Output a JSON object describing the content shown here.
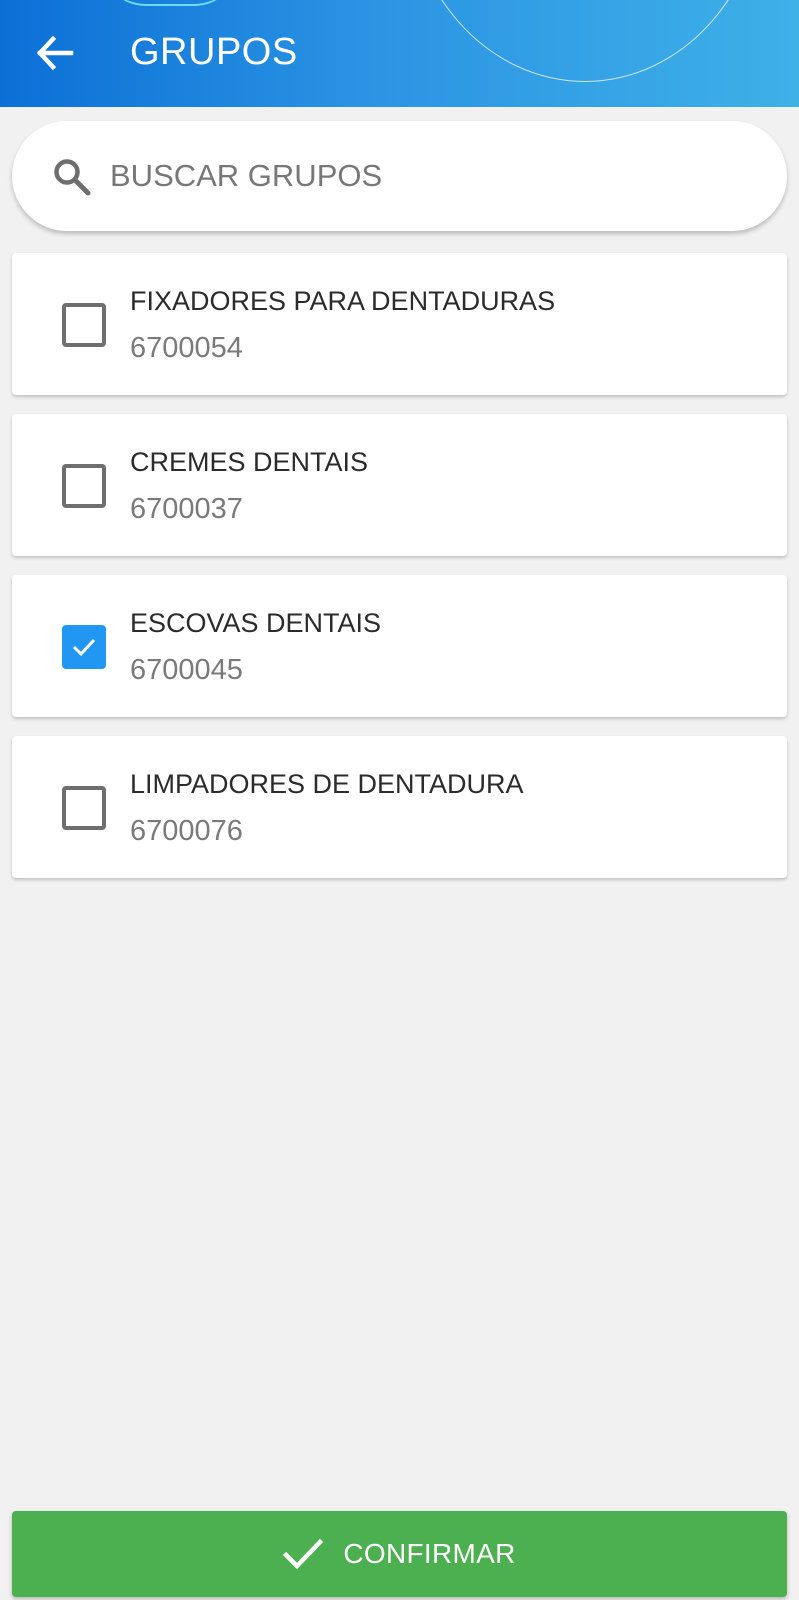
{
  "header": {
    "title": "GRUPOS",
    "back_icon": "arrow-left-icon",
    "background_colors": [
      "#0b6fd6",
      "#3fb0e8"
    ]
  },
  "search": {
    "placeholder": "BUSCAR GRUPOS",
    "value": "",
    "icon": "search-icon"
  },
  "groups": [
    {
      "title": "FIXADORES PARA DENTADURAS",
      "code": "6700054",
      "checked": false
    },
    {
      "title": "CREMES DENTAIS",
      "code": "6700037",
      "checked": false
    },
    {
      "title": "ESCOVAS DENTAIS",
      "code": "6700045",
      "checked": true
    },
    {
      "title": "LIMPADORES DE DENTADURA",
      "code": "6700076",
      "checked": false
    }
  ],
  "confirm": {
    "label": "CONFIRMAR",
    "icon": "check-icon",
    "color": "#4caf50"
  },
  "colors": {
    "checkbox_checked": "#2196f3",
    "page_background": "#f1f1f1"
  }
}
